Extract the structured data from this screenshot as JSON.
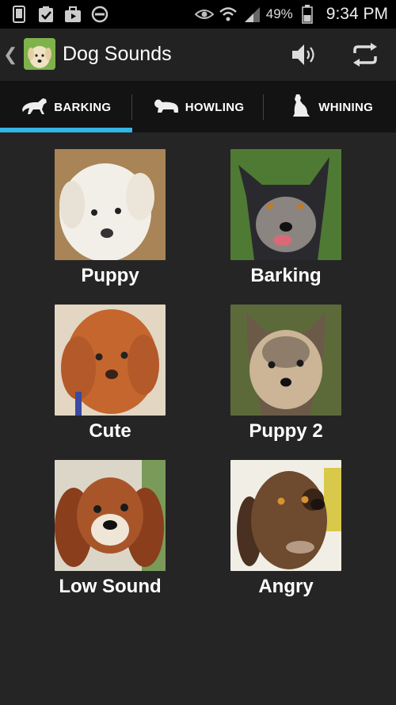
{
  "status": {
    "battery_percent": "49%",
    "time": "9:34 PM",
    "icons": [
      "phone-icon",
      "clipboard-check-icon",
      "briefcase-play-icon",
      "do-not-disturb-icon",
      "eye-icon",
      "wifi-icon",
      "signal-icon",
      "battery-icon"
    ]
  },
  "action_bar": {
    "title": "Dog Sounds",
    "icons": [
      "chevron-left-icon",
      "app-dog-icon",
      "speaker-icon",
      "repeat-icon"
    ]
  },
  "tabs": [
    {
      "label": "BARKING",
      "icon": "dog-running-icon",
      "selected": true
    },
    {
      "label": "HOWLING",
      "icon": "dog-lying-icon",
      "selected": false
    },
    {
      "label": "WHINING",
      "icon": "dog-sitting-icon",
      "selected": false
    }
  ],
  "sounds": [
    {
      "label": "Puppy"
    },
    {
      "label": "Barking"
    },
    {
      "label": "Cute"
    },
    {
      "label": "Puppy 2"
    },
    {
      "label": "Low Sound"
    },
    {
      "label": "Angry"
    }
  ],
  "colors": {
    "accent": "#33b5e5",
    "background": "#252525",
    "tab_bar": "#131313"
  }
}
